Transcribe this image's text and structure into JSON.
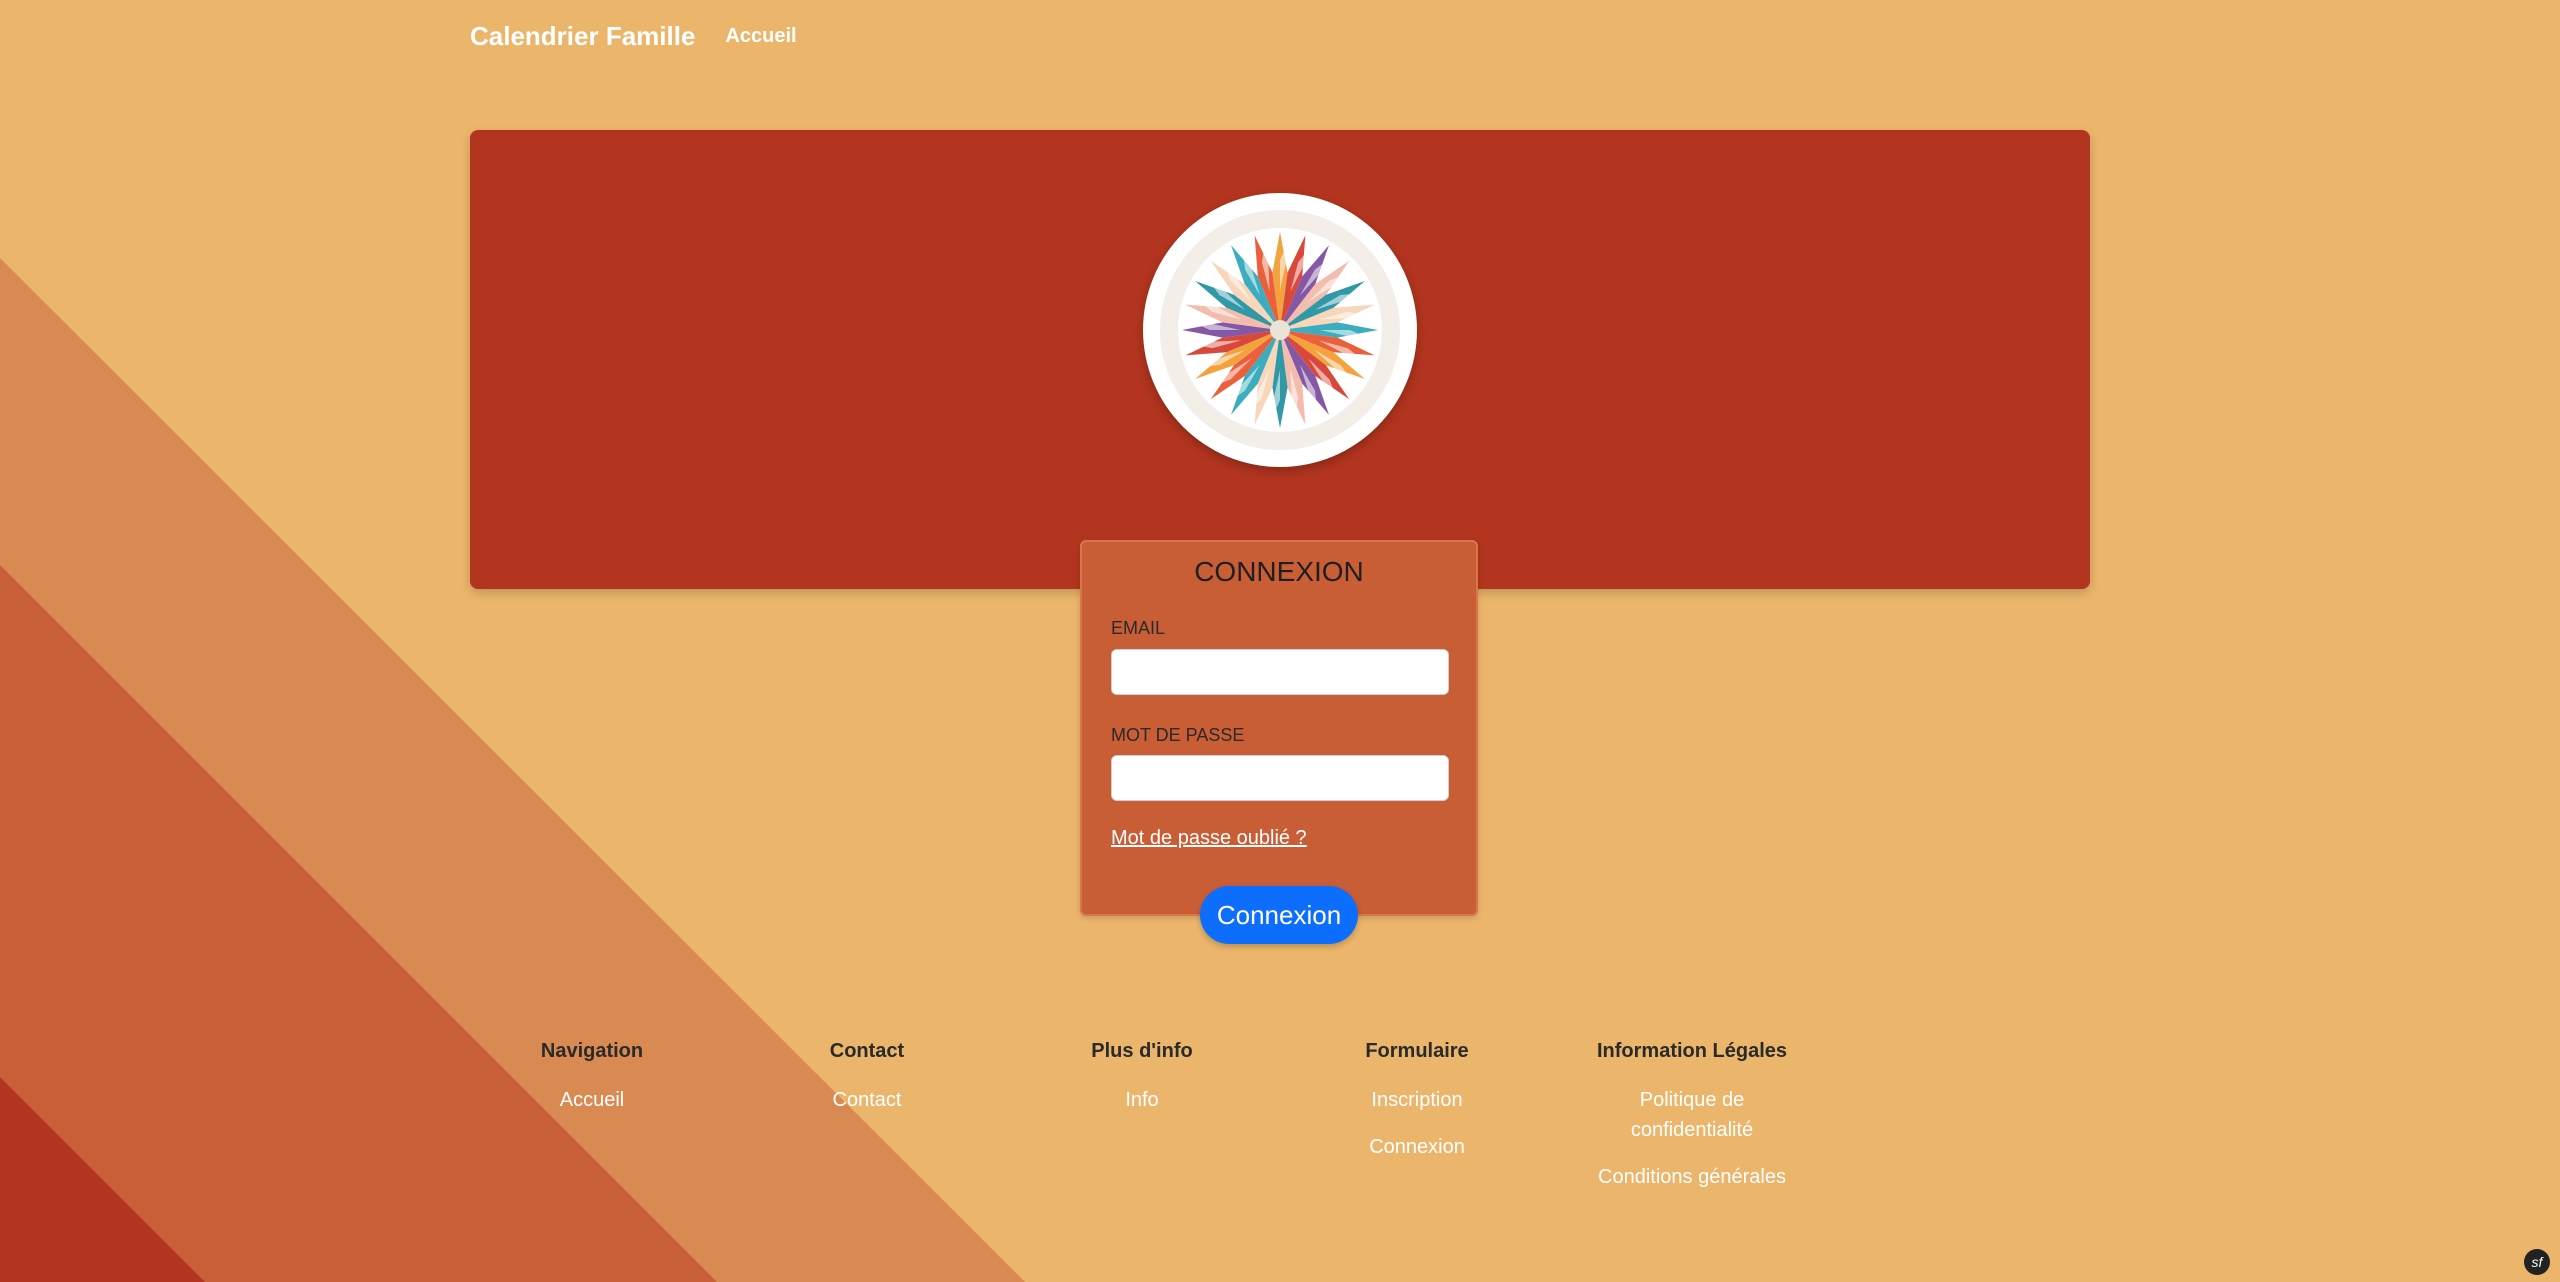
{
  "header": {
    "brand": "Calendrier Famille",
    "nav_home": "Accueil"
  },
  "login": {
    "title": "CONNEXION",
    "email_label": "EMAIL",
    "email_value": "",
    "password_label": "MOT DE PASSE",
    "password_value": "",
    "forgot_link": "Mot de passe oublié ?",
    "submit_label": "Connexion"
  },
  "footer": {
    "columns": [
      {
        "heading": "Navigation",
        "links": [
          "Accueil"
        ]
      },
      {
        "heading": "Contact",
        "links": [
          "Contact"
        ]
      },
      {
        "heading": "Plus d'info",
        "links": [
          "Info"
        ]
      },
      {
        "heading": "Formulaire",
        "links": [
          "Inscription",
          "Connexion"
        ]
      },
      {
        "heading": "Information Légales",
        "links": [
          "Politique de confidentialité",
          "Conditions générales"
        ]
      }
    ]
  },
  "colors": {
    "page_bg": "#ebb56b",
    "hero": "#b3351f",
    "card": "#c85d36",
    "button": "#0d6efd",
    "stripe_light": "#d98a52",
    "stripe_mid": "#c95f38",
    "stripe_dark": "#b3351f"
  },
  "icons": {
    "logo": "origami-mandala-logo",
    "debug_toolbar": "symfony-sf-icon"
  },
  "debug_icon_text": "sf"
}
